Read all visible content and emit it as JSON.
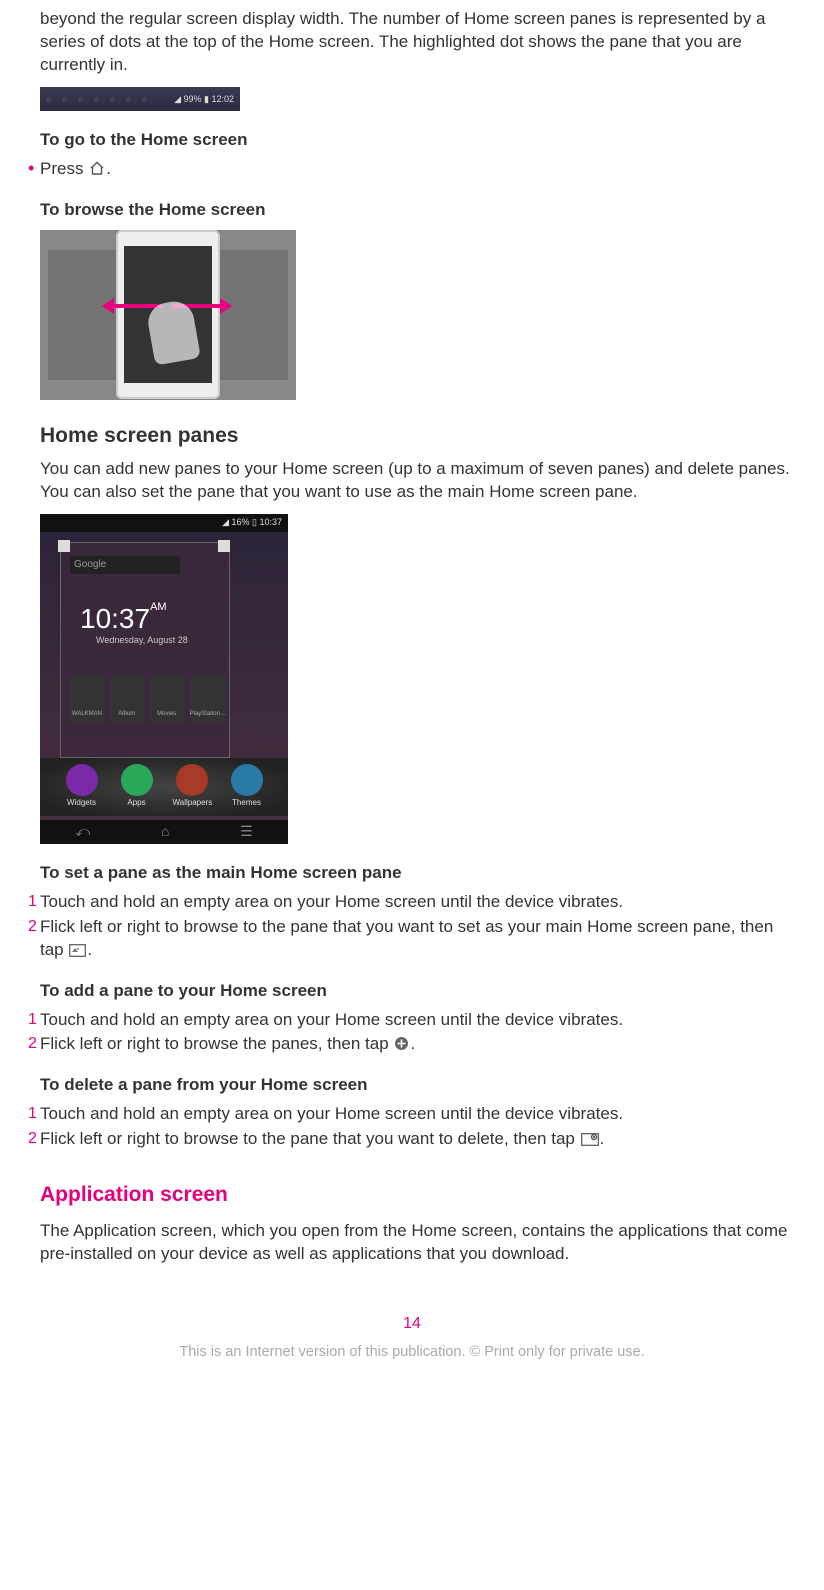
{
  "intro_paragraph": "beyond the regular screen display width. The number of Home screen panes is represented by a series of dots at the top of the Home screen. The highlighted dot shows the pane that you are currently in.",
  "statusbar": {
    "dots": "○ ○ ○ ○ ○ ○ ○",
    "right": "◢ 99% ▮ 12:02"
  },
  "go_home": {
    "heading": "To go to the Home screen",
    "bullet_pre": "Press ",
    "bullet_post": "."
  },
  "browse_home": {
    "heading": "To browse the Home screen"
  },
  "panes_section": {
    "heading": "Home screen panes",
    "body": "You can add new panes to your Home screen (up to a maximum of seven panes) and delete panes. You can also set the pane that you want to use as the main Home screen pane."
  },
  "panes_img": {
    "status": "◢ 16% ▯ 10:37",
    "google": "Google",
    "clock": "10:37",
    "clock_ampm": "AM",
    "clock_sub": "Wednesday, August 28",
    "thumbs": [
      "WALKMAN",
      "Album",
      "Movies",
      "PlayStation…"
    ],
    "wheel": [
      {
        "label": "Widgets",
        "color": "#7a2aa8"
      },
      {
        "label": "Apps",
        "color": "#2aa85a"
      },
      {
        "label": "Wallpapers",
        "color": "#a83a2a"
      },
      {
        "label": "Themes",
        "color": "#2a7aa8"
      }
    ]
  },
  "set_main": {
    "heading": "To set a pane as the main Home screen pane",
    "step1": "Touch and hold an empty area on your Home screen until the device vibrates.",
    "step2_pre": "Flick left or right to browse to the pane that you want to set as your main Home screen pane, then tap ",
    "step2_post": "."
  },
  "add_pane": {
    "heading": "To add a pane to your Home screen",
    "step1": "Touch and hold an empty area on your Home screen until the device vibrates.",
    "step2_pre": "Flick left or right to browse the panes, then tap ",
    "step2_post": "."
  },
  "delete_pane": {
    "heading": "To delete a pane from your Home screen",
    "step1": "Touch and hold an empty area on your Home screen until the device vibrates.",
    "step2_pre": "Flick left or right to browse to the pane that you want to delete, then tap ",
    "step2_post": "."
  },
  "app_screen": {
    "heading": "Application screen",
    "body": "The Application screen, which you open from the Home screen, contains the applications that come pre-installed on your device as well as applications that you download."
  },
  "page_number": "14",
  "footer": "This is an Internet version of this publication. © Print only for private use.",
  "markers": {
    "one": "1",
    "two": "2",
    "bullet": "•"
  }
}
